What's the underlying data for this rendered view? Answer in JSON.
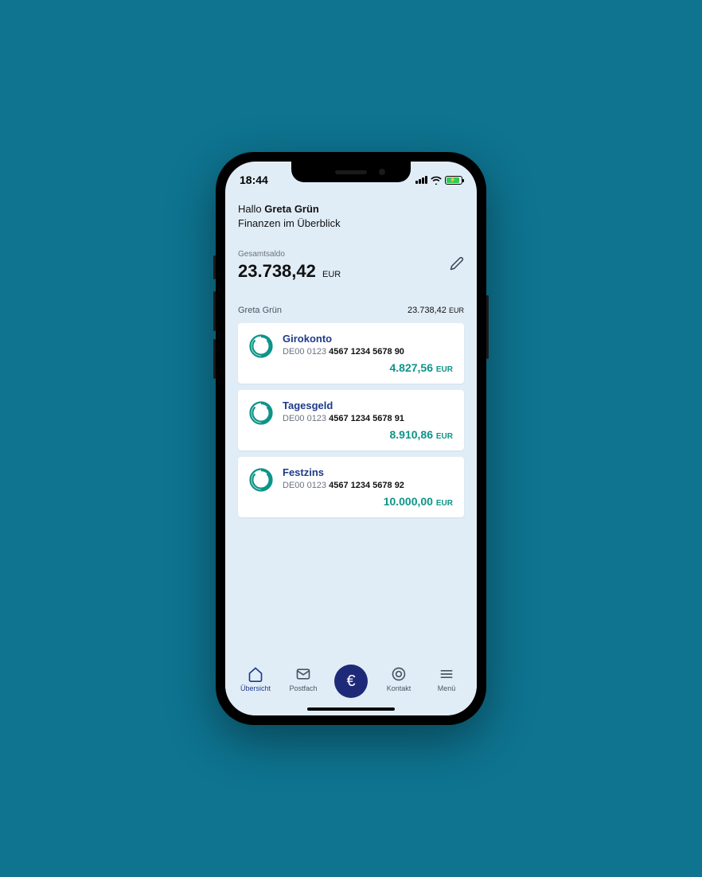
{
  "status": {
    "time": "18:44"
  },
  "header": {
    "greeting_prefix": "Hallo ",
    "user_name": "Greta Grün",
    "subtitle": "Finanzen im Überblick"
  },
  "total": {
    "label": "Gesamtsaldo",
    "amount": "23.738,42",
    "currency": "EUR"
  },
  "owner": {
    "name": "Greta Grün",
    "amount": "23.738,42",
    "currency": "EUR"
  },
  "accounts": [
    {
      "title": "Girokonto",
      "iban_prefix": "DE00 0123 ",
      "iban_main": "4567 1234 5678 90",
      "balance": "4.827,56",
      "currency": "EUR"
    },
    {
      "title": "Tagesgeld",
      "iban_prefix": "DE00 0123 ",
      "iban_main": "4567 1234 5678 91",
      "balance": "8.910,86",
      "currency": "EUR"
    },
    {
      "title": "Festzins",
      "iban_prefix": "DE00 0123 ",
      "iban_main": "4567 1234 5678 92",
      "balance": "10.000,00",
      "currency": "EUR"
    }
  ],
  "tabs": {
    "overview": "Übersicht",
    "inbox": "Postfach",
    "euro": "€",
    "contact": "Kontakt",
    "menu": "Menü"
  }
}
